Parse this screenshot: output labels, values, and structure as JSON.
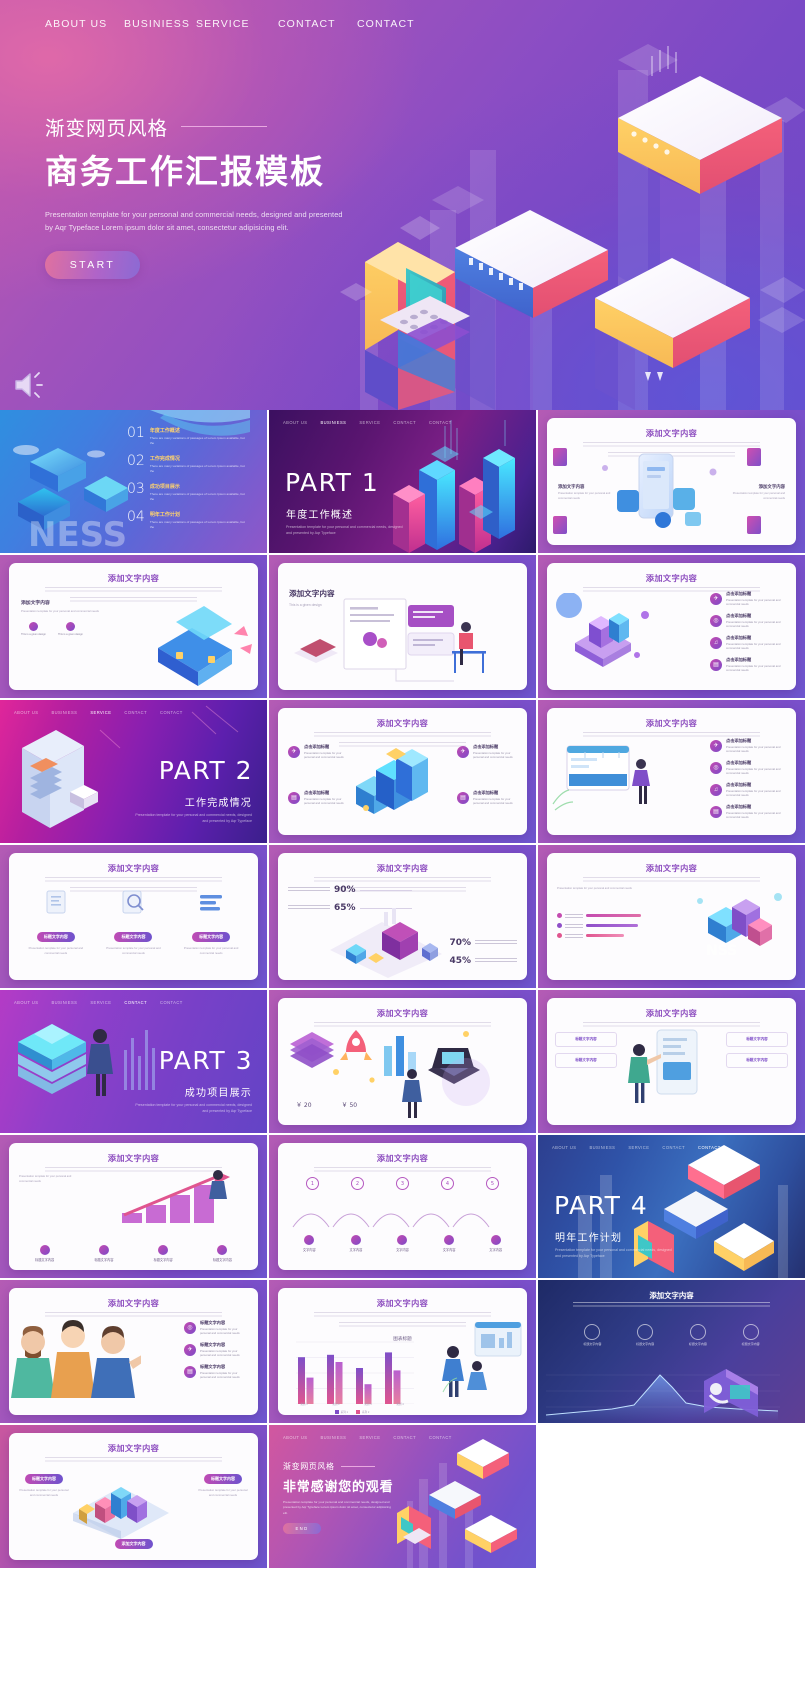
{
  "hero": {
    "nav": [
      {
        "label": "ABOUT US"
      },
      {
        "label": "BUSINIESS"
      },
      {
        "label": "SERVICE"
      },
      {
        "label": "CONTACT"
      },
      {
        "label": "CONTACT"
      }
    ],
    "sup_title": "渐变网页风格",
    "title": "商务工作汇报模板",
    "description": "Presentation template for your personal and commercial needs, designed and presented by Aqr Typeface Lorem ipsum dolor sit amet, consectetur adipisicing elit.",
    "start_button": "START",
    "speaker_icon": "speaker-icon"
  },
  "colors": {
    "accent_pink": "#e0719f",
    "accent_purple": "#8b6ad4",
    "brand_violet": "#7b4ec9",
    "gold": "#ffd36e"
  },
  "slides": {
    "index": {
      "items": [
        {
          "num": "01",
          "title": "年度工作概述",
          "desc": "There are many variations of passages of Lorem Ipsum available, but the"
        },
        {
          "num": "02",
          "title": "工作完成情况",
          "desc": "There are many variations of passages of Lorem Ipsum available, but the"
        },
        {
          "num": "03",
          "title": "成功项目展示",
          "desc": "There are many variations of passages of Lorem Ipsum available, but the"
        },
        {
          "num": "04",
          "title": "明年工作计划",
          "desc": "There are many variations of passages of Lorem Ipsum available, but the"
        }
      ]
    },
    "part1": {
      "label": "PART 1",
      "sub": "年度工作概述",
      "desc": "Presentation template for your personal and commercial needs, designed and presented by Aqr Typeface"
    },
    "part2": {
      "label": "PART 2",
      "sub": "工作完成情况",
      "desc": "Presentation template for your personal and commercial needs, designed and presented by Aqr Typeface"
    },
    "part3": {
      "label": "PART 3",
      "sub": "成功项目展示",
      "desc": "Presentation template for your personal and commercial needs, designed and presented by Aqr Typeface"
    },
    "part4": {
      "label": "PART 4",
      "sub": "明年工作计划",
      "desc": "Presentation template for your personal and commercial needs, designed and presented by Aqr Typeface"
    },
    "ending": {
      "sup_title": "渐变网页风格",
      "title": "非常感谢您的观看",
      "desc": "Presentation template for your personal and commercial needs, designed and presented by Aqr Typeface Lorem ipsum dolor sit amet, consectetur adipisicing elit.",
      "button": "END"
    },
    "common": {
      "card_title": "添加文字内容",
      "bullet_title_a": "点击添加标题",
      "bullet_title_b": "点击添加标题",
      "bullet_desc": "Presentation template for your personal and commercial needs",
      "tag_title": "标题文字内容",
      "body_text": "This is a given design"
    },
    "percent_slide": {
      "values": [
        "90%",
        "65%",
        "70%",
        "45%"
      ],
      "title": "添加文字内容"
    },
    "price_slide": {
      "prices": [
        "￥ 20",
        "￥ 50"
      ]
    },
    "steps_slide": {
      "steps": [
        "1",
        "2",
        "3",
        "4",
        "5"
      ],
      "labels": [
        "文字内容",
        "文字内容",
        "文字内容",
        "文字内容",
        "文字内容"
      ]
    },
    "chart_slide": {
      "title": "添加文字内容",
      "chart_title": "图表标题"
    }
  },
  "chart_data": {
    "type": "bar",
    "title": "图表标题",
    "categories": [
      "类别 1",
      "类别 2",
      "类别 3",
      "类别 4"
    ],
    "series": [
      {
        "name": "系列 1",
        "values": [
          78,
          82,
          60,
          86
        ]
      },
      {
        "name": "系列 2",
        "values": [
          44,
          70,
          33,
          56
        ]
      }
    ],
    "xlabel": "",
    "ylabel": "",
    "ylim": [
      0,
      100
    ],
    "grid": true,
    "legend_position": "bottom"
  }
}
